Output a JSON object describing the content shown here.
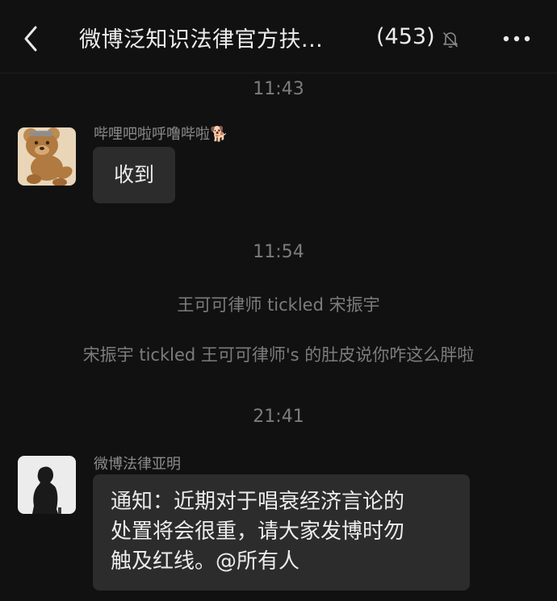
{
  "header": {
    "title": "微博泛知识法律官方扶...",
    "member_count": "(453)"
  },
  "messages": {
    "time1": "11:43",
    "msg1": {
      "sender": "哔哩吧啦呼噜哔啦🐕",
      "text": "收到"
    },
    "time2": "11:54",
    "system1": "王可可律师 tickled 宋振宇",
    "system2": "宋振宇 tickled 王可可律师's 的肚皮说你咋这么胖啦",
    "time3": "21:41",
    "msg2": {
      "sender": "微博法律亚明",
      "text_lines": [
        "通知：近期对于唱衰经济言论的",
        "处置将会很重，请大家发博时勿",
        "触及红线。@所有人"
      ]
    }
  }
}
